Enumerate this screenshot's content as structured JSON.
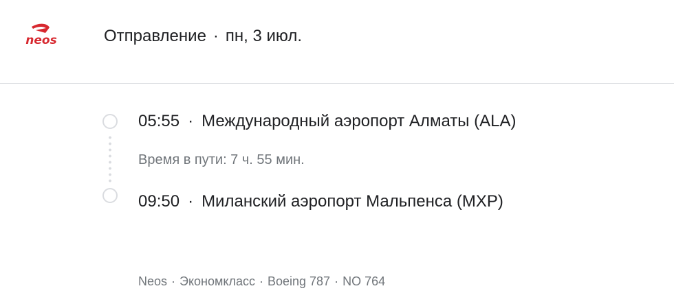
{
  "airline": {
    "logo_text": "neos",
    "logo_color": "#d7282f"
  },
  "header": {
    "label": "Отправление",
    "separator": "·",
    "date": "пн, 3 июл."
  },
  "departure": {
    "time": "05:55",
    "separator": "·",
    "airport": "Международный аэропорт Алматы (ALA)"
  },
  "duration": "Время в пути: 7 ч. 55 мин.",
  "arrival": {
    "time": "09:50",
    "separator": "·",
    "airport": "Миланский аэропорт Мальпенса (MXP)"
  },
  "details": {
    "airline": "Neos",
    "cabin": "Экономкласс",
    "aircraft": "Boeing 787",
    "flight_number": "NO 764",
    "separator": "·"
  },
  "colors": {
    "primary_text": "#202124",
    "secondary_text": "#70757a",
    "divider": "#dadce0"
  }
}
